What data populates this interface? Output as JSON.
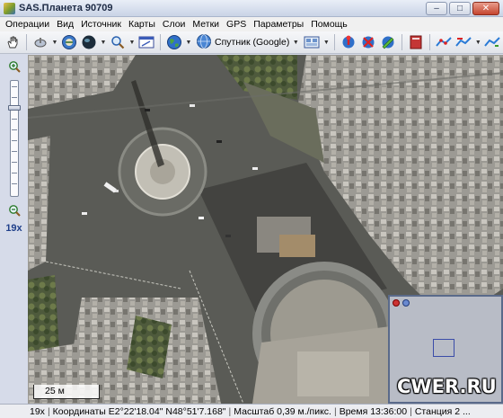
{
  "window": {
    "title": "SAS.Планета 90709",
    "minimize_glyph": "–",
    "maximize_glyph": "□",
    "close_glyph": "✕"
  },
  "menu": [
    "Операции",
    "Вид",
    "Источник",
    "Карты",
    "Слои",
    "Метки",
    "GPS",
    "Параметры",
    "Помощь"
  ],
  "toolbar": {
    "map_type_label": "Спутник (Google)",
    "icons": [
      "hand-pan-icon",
      "satellite-dish-icon",
      "globe-gps-icon",
      "dark-sphere-icon",
      "magnifier-icon",
      "window-select-icon",
      "earth-icon",
      "satellite-globe-icon",
      "layers-grid-icon",
      "marker-add-icon",
      "marker-delete-icon",
      "marker-edit-icon",
      "book-icon",
      "route-1-icon",
      "route-2-icon",
      "route-3-icon"
    ]
  },
  "zoom": {
    "level_label": "19x",
    "level_fraction": 0.78
  },
  "map": {
    "scale_label": "25 м",
    "watermark": "CWER.RU"
  },
  "status": {
    "zoom": "19x",
    "coordinates": "Координаты E2°22'18.04\" N48°51'7.168\"",
    "scale": "Масштаб 0,39 м./пикс.",
    "time": "Время 13:36:00",
    "extra": "Станция 2 ..."
  }
}
